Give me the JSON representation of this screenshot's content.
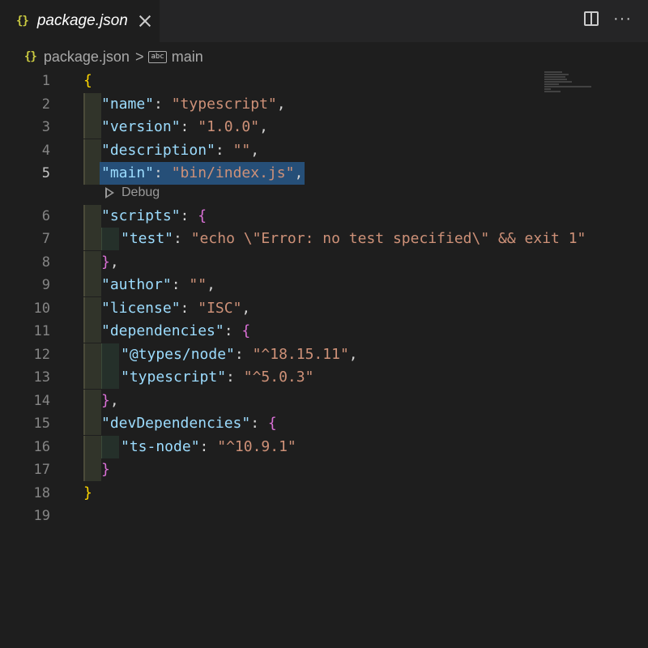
{
  "tab": {
    "icon": "{}",
    "label": "package.json",
    "close": "close-icon"
  },
  "actions": {
    "split": "split-editor-icon",
    "more": "···"
  },
  "breadcrumb": {
    "icon": "{}",
    "file": "package.json",
    "chevron": ">",
    "symbol_icon": "abc",
    "symbol": "main"
  },
  "codelens": {
    "label": "Debug"
  },
  "lines": [
    "1",
    "2",
    "3",
    "4",
    "5",
    "6",
    "7",
    "8",
    "9",
    "10",
    "11",
    "12",
    "13",
    "14",
    "15",
    "16",
    "17",
    "18",
    "19"
  ],
  "code": {
    "open": "{",
    "name_k": "\"name\"",
    "name_v": "\"typescript\"",
    "version_k": "\"version\"",
    "version_v": "\"1.0.0\"",
    "description_k": "\"description\"",
    "description_v": "\"\"",
    "main_k": "\"main\"",
    "main_v": "\"bin/index.js\"",
    "scripts_k": "\"scripts\"",
    "test_k": "\"test\"",
    "test_v": "\"echo \\\"Error: no test specified\\\" && exit 1\"",
    "author_k": "\"author\"",
    "author_v": "\"\"",
    "license_k": "\"license\"",
    "license_v": "\"ISC\"",
    "dependencies_k": "\"dependencies\"",
    "types_node_k": "\"@types/node\"",
    "types_node_v": "\"^18.15.11\"",
    "typescript_k": "\"typescript\"",
    "typescript_v": "\"^5.0.3\"",
    "devdeps_k": "\"devDependencies\"",
    "tsnode_k": "\"ts-node\"",
    "tsnode_v": "\"^10.9.1\"",
    "close": "}"
  }
}
